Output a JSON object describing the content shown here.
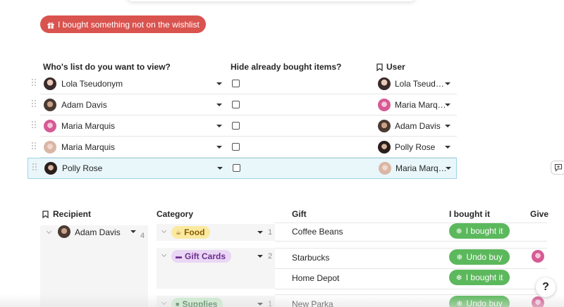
{
  "wishlist_button": {
    "label": "I bought something not on the wishlist",
    "color": "#d9534f"
  },
  "list_table": {
    "headers": {
      "whose_list": "Who's list do you want to view?",
      "hide_bought": "Hide already bought items?",
      "user": "User"
    },
    "rows": [
      {
        "list_owner": "Lola Tseudonym",
        "hide_bought": false,
        "user": "Lola Tseud…",
        "selected": false
      },
      {
        "list_owner": "Adam Davis",
        "hide_bought": false,
        "user": "Maria Marq…",
        "selected": false
      },
      {
        "list_owner": "Maria Marquis",
        "hide_bought": false,
        "user": "Adam Davis",
        "selected": false
      },
      {
        "list_owner": "Maria Marquis",
        "hide_bought": false,
        "user": "Polly Rose",
        "selected": false
      },
      {
        "list_owner": "Polly Rose",
        "hide_bought": false,
        "user": "Maria Marq…",
        "selected": true
      }
    ]
  },
  "gifts_table": {
    "headers": {
      "recipient": "Recipient",
      "category": "Category",
      "gift": "Gift",
      "bought": "I bought it",
      "giver": "Give"
    },
    "recipient": {
      "name": "Adam Davis",
      "count": "4"
    },
    "categories": [
      {
        "label": "Food",
        "count": "1",
        "color": "#fbe9a0",
        "text_color": "#8a5a00"
      },
      {
        "label": "Gift Cards",
        "count": "2",
        "color": "#ead6f5",
        "text_color": "#6b2f8a"
      },
      {
        "label": "Supplies",
        "count": "1",
        "color": "#cdeccf",
        "text_color": "#2c6b33"
      }
    ],
    "gifts": [
      {
        "name": "Coffee Beans",
        "action": "I bought it",
        "has_giver": false
      },
      {
        "name": "Starbucks",
        "action": "Undo buy",
        "has_giver": true
      },
      {
        "name": "Home Depot",
        "action": "I bought it",
        "has_giver": false
      },
      {
        "name": "New Parka",
        "action": "Undo buy",
        "has_giver": true
      }
    ],
    "buy_color": "#5cb85c"
  },
  "help_button": {
    "label": "?"
  }
}
